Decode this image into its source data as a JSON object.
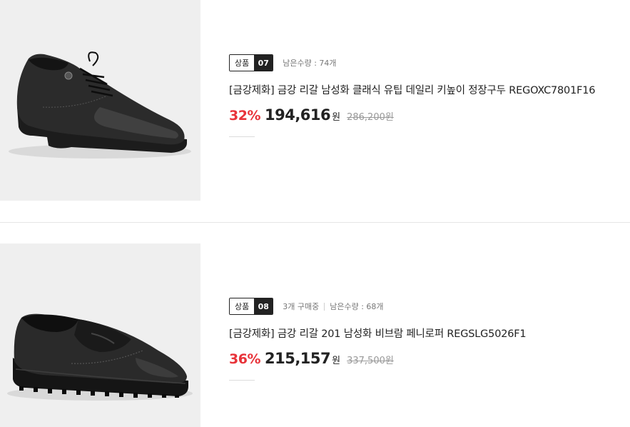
{
  "products": [
    {
      "badge_label": "상품",
      "badge_num": "07",
      "buying": "",
      "stock": "남은수량 : 74개",
      "title": "[금강제화] 금강 리갈 남성화 클래식 유팁 데일리 키높이 정장구두 REGOXC7801F16",
      "discount": "32%",
      "price": "194,616",
      "won": "원",
      "original_price": "286,200",
      "original_won": "원",
      "image": "black-derby-shoe"
    },
    {
      "badge_label": "상품",
      "badge_num": "08",
      "buying": "3개 구매중",
      "stock": "남은수량 : 68개",
      "title": "[금강제화] 금강 리갈 201 남성화 비브람 페니로퍼 REGSLG5026F1",
      "discount": "36%",
      "price": "215,157",
      "won": "원",
      "original_price": "337,500",
      "original_won": "원",
      "image": "black-penny-loafer"
    }
  ],
  "colors": {
    "discount": "#e8333a",
    "badge_dark": "#222222",
    "image_bg": "#efefef"
  }
}
